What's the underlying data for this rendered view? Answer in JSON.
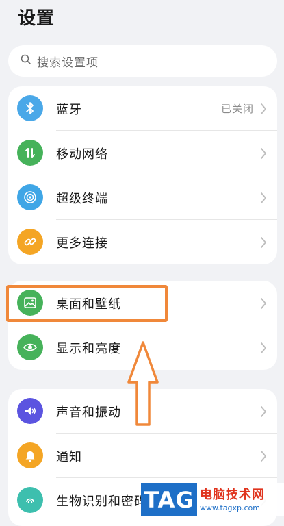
{
  "page": {
    "title": "设置"
  },
  "search": {
    "placeholder": "搜索设置项"
  },
  "groups": [
    {
      "items": [
        {
          "label": "蓝牙",
          "value": "已关闭",
          "icon": "bluetooth-icon",
          "color": "#4aa8e8"
        },
        {
          "label": "移动网络",
          "icon": "mobile-data-icon",
          "color": "#46b25a"
        },
        {
          "label": "超级终端",
          "icon": "super-device-icon",
          "color": "#3fa6e6"
        },
        {
          "label": "更多连接",
          "icon": "link-icon",
          "color": "#f4a524"
        }
      ]
    },
    {
      "items": [
        {
          "label": "桌面和壁纸",
          "icon": "wallpaper-icon",
          "color": "#46b25a"
        },
        {
          "label": "显示和亮度",
          "icon": "eye-icon",
          "color": "#46b25a"
        }
      ]
    },
    {
      "items": [
        {
          "label": "声音和振动",
          "icon": "sound-icon",
          "color": "#5b54e0"
        },
        {
          "label": "通知",
          "icon": "bell-icon",
          "color": "#f4a524"
        },
        {
          "label": "生物识别和密码",
          "icon": "fingerprint-icon",
          "color": "#3dbfae"
        }
      ]
    }
  ],
  "annotation": {
    "highlight_color": "#f0883a"
  },
  "watermark": {
    "tag": "TAG",
    "name": "电脑技术网",
    "url": "www.tagxp.com"
  }
}
